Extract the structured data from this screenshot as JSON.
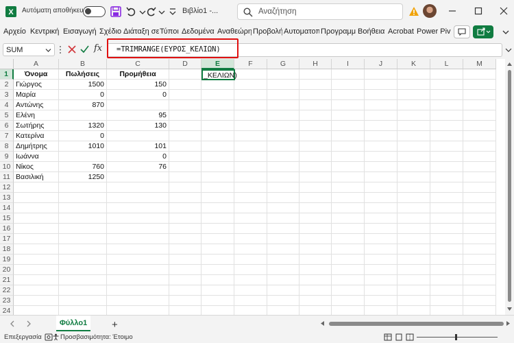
{
  "titlebar": {
    "autosave_label": "Αυτόματη αποθήκευση",
    "doc_title": "Βιβλίο1  -...",
    "search_placeholder": "Αναζήτηση"
  },
  "ribbon": {
    "tabs": [
      "Αρχείο",
      "Κεντρική",
      "Εισαγωγή",
      "Σχέδιο",
      "Διάταξη σε",
      "Τύποι",
      "Δεδομένα",
      "Αναθεώρη",
      "Προβολή",
      "Αυτοματοπ",
      "Προγραμμ",
      "Βοήθεια",
      "Acrobat",
      "Power Pivo"
    ]
  },
  "formula_bar": {
    "name_box": "SUM",
    "fx": "fx",
    "formula": "=TRIMRANGE(ΕΥΡΟΣ_ΚΕΛΙΩΝ)"
  },
  "grid": {
    "columns": [
      "A",
      "B",
      "C",
      "D",
      "E",
      "F",
      "G",
      "H",
      "I",
      "J",
      "K",
      "L",
      "M"
    ],
    "selected_column": "E",
    "selected_row": 1,
    "row_count": 25,
    "active_cell_text": "_ΚΕΛΙΩΝ)",
    "headers": [
      "Όνομα",
      "Πωλήσεις",
      "Προμήθεια"
    ],
    "rows": [
      [
        "Γιώργος",
        "1500",
        "150"
      ],
      [
        "Μαρία",
        "0",
        "0"
      ],
      [
        "Αντώνης",
        "870",
        ""
      ],
      [
        "Ελένη",
        "",
        "95"
      ],
      [
        "Σωτήρης",
        "1320",
        "130"
      ],
      [
        "Κατερίνα",
        "0",
        ""
      ],
      [
        "Δημήτρης",
        "1010",
        "101"
      ],
      [
        "Ιωάννα",
        "",
        "0"
      ],
      [
        "Νίκος",
        "760",
        "76"
      ],
      [
        "Βασιλική",
        "1250",
        ""
      ]
    ]
  },
  "sheets": {
    "active": "Φύλλο1",
    "add_label": "+"
  },
  "status": {
    "mode": "Επεξεργασία",
    "accessibility": "Προσβασιμότητα: Έτοιμο"
  },
  "colors": {
    "accent": "#107c41",
    "highlight": "#e01010"
  }
}
